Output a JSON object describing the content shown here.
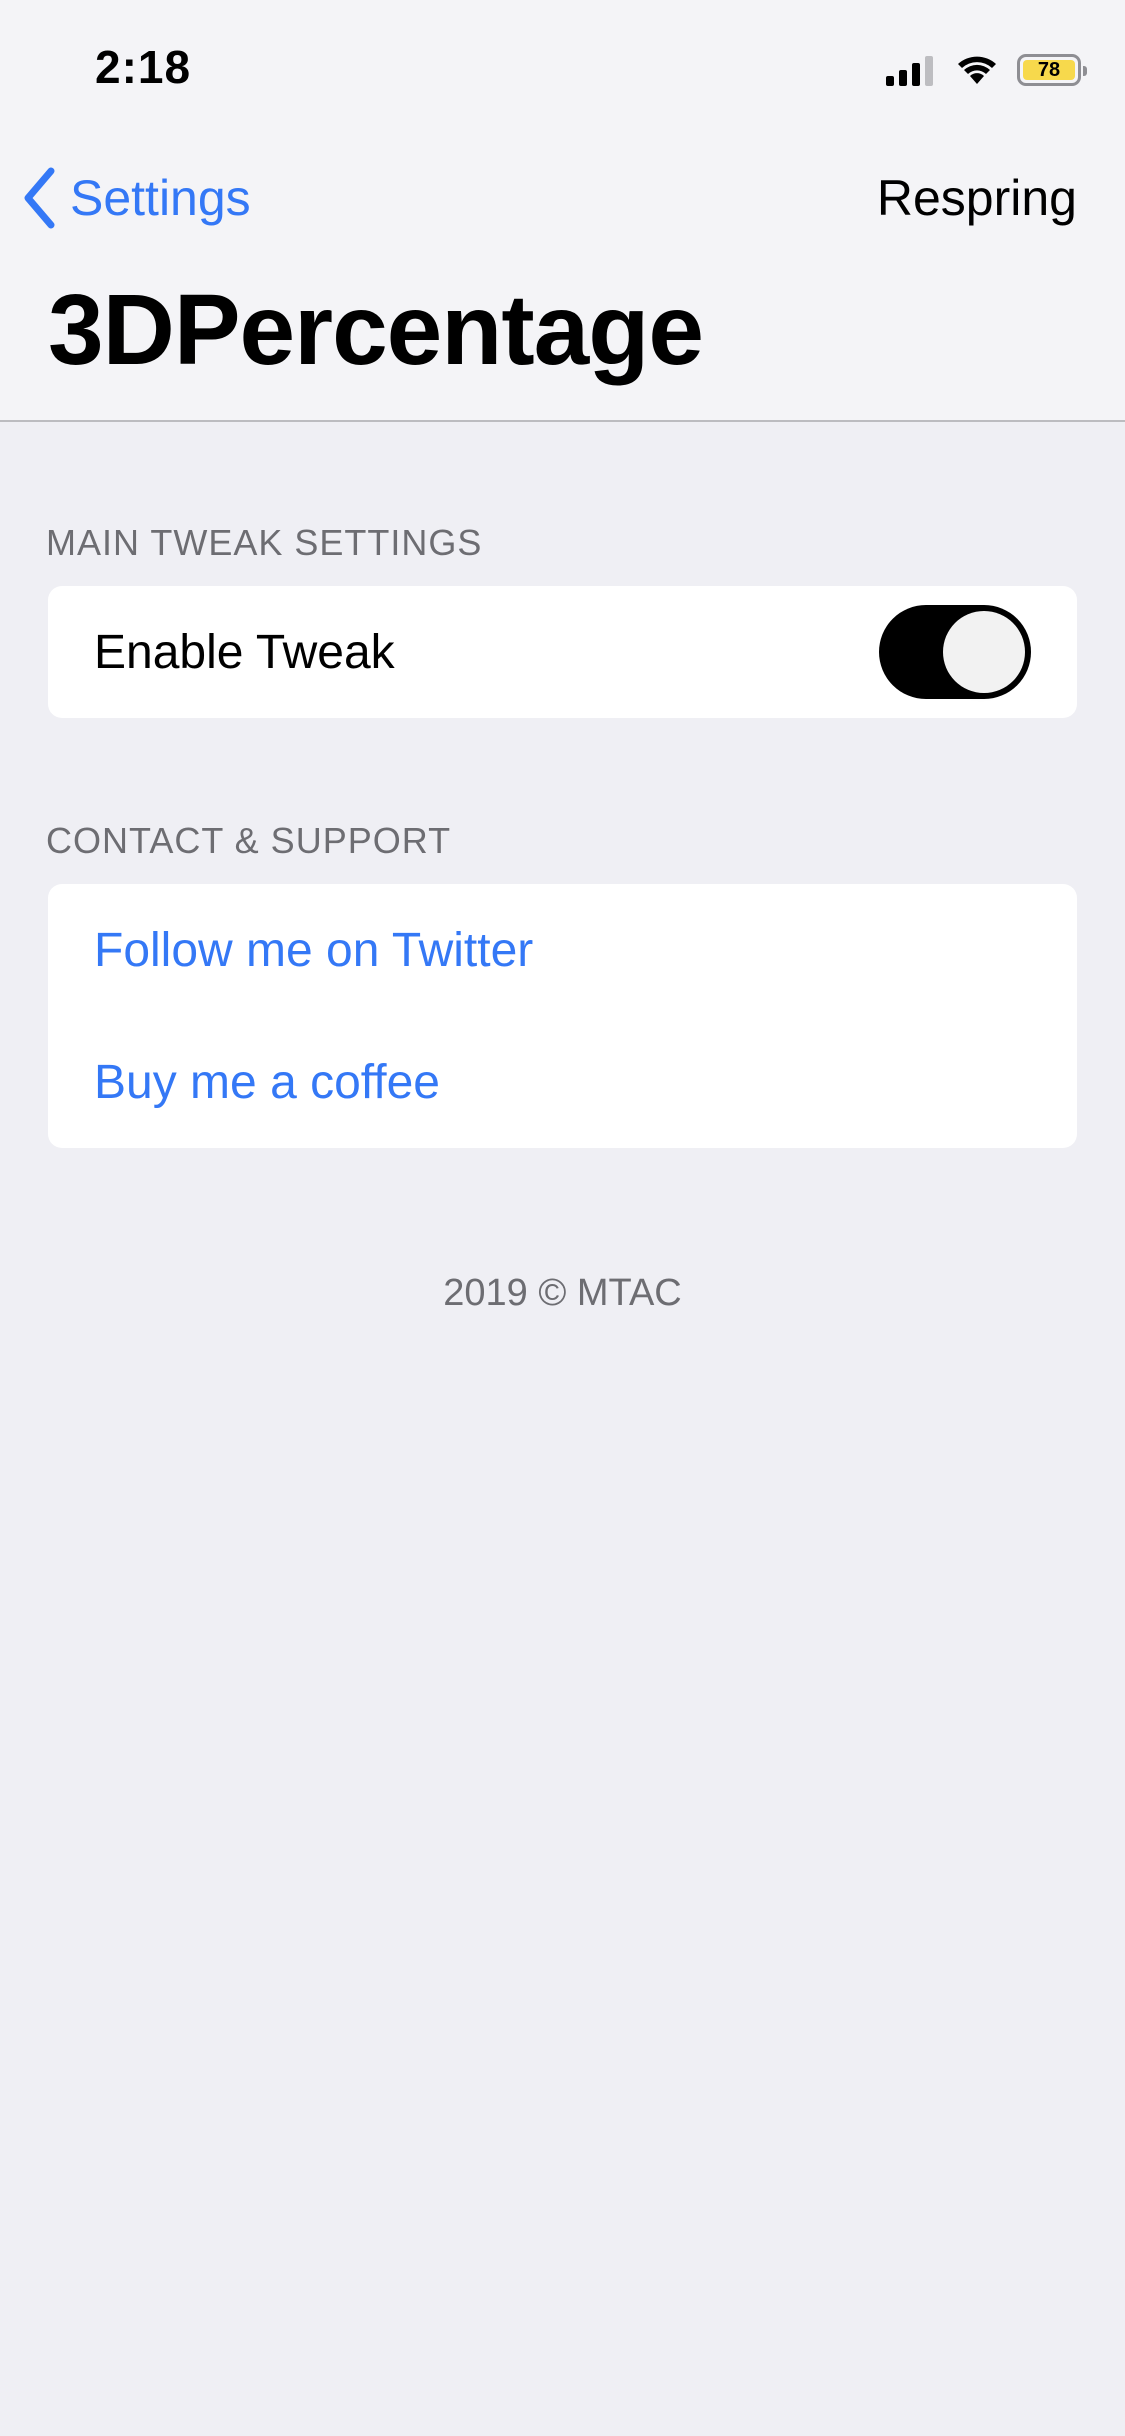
{
  "status_bar": {
    "time": "2:18",
    "battery_level": "78",
    "signal_bars": 3,
    "icons": [
      "signal-icon",
      "wifi-icon",
      "battery-icon"
    ]
  },
  "nav": {
    "back_label": "Settings",
    "right_button_label": "Respring",
    "title": "3DPercentage"
  },
  "sections": [
    {
      "header": "MAIN TWEAK SETTINGS",
      "rows": [
        {
          "label": "Enable Tweak",
          "type": "toggle",
          "value": true
        }
      ]
    },
    {
      "header": "CONTACT & SUPPORT",
      "rows": [
        {
          "label": "Follow me on Twitter",
          "type": "link"
        },
        {
          "label": "Buy me a coffee",
          "type": "link"
        }
      ]
    }
  ],
  "footer": "2019 © MTAC",
  "colors": {
    "accent": "#3478f6",
    "background": "#efeff4",
    "toggle_on": "#000000",
    "battery_fill": "#f7d94c"
  }
}
